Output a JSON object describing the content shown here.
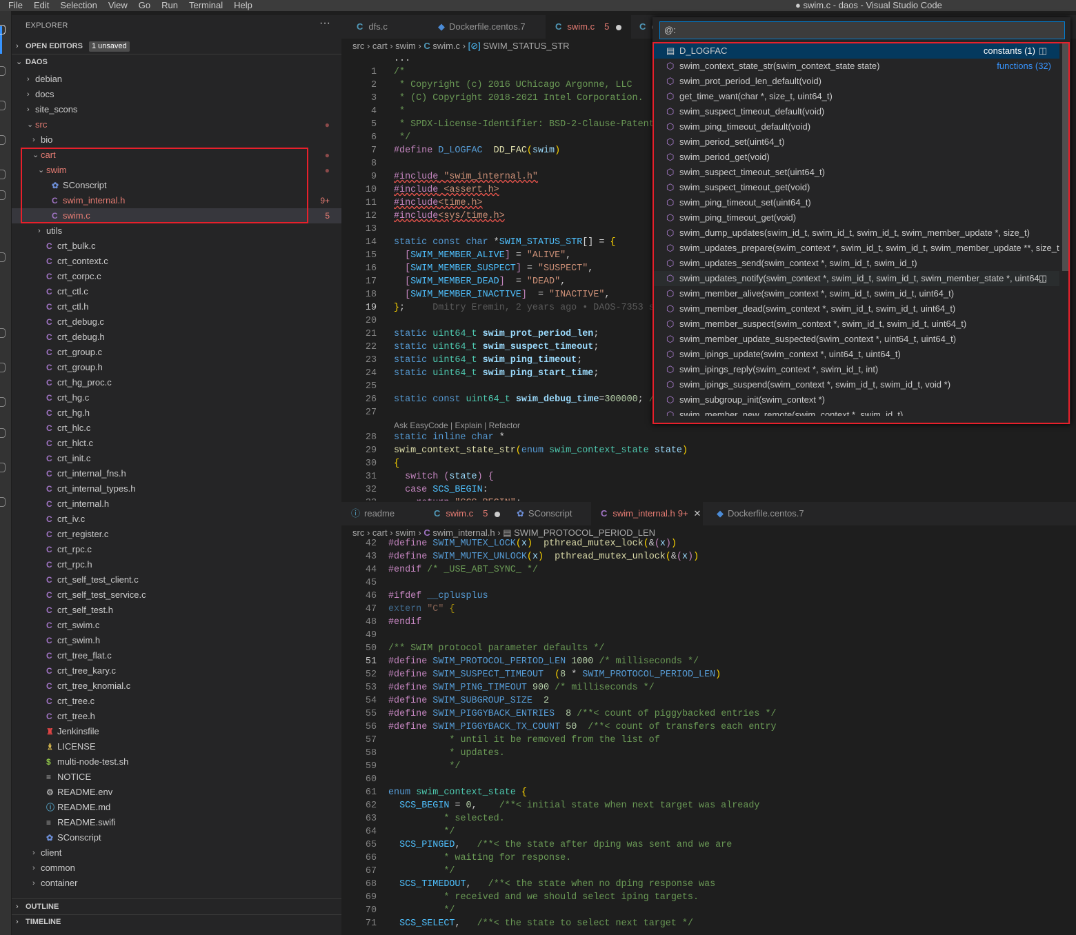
{
  "titlebar": {
    "menus": [
      "File",
      "Edit",
      "Selection",
      "View",
      "Go",
      "Run",
      "Terminal",
      "Help"
    ],
    "title": "● swim.c - daos - Visual Studio Code"
  },
  "explorer": {
    "header": "EXPLORER",
    "more": "···",
    "open_editors": {
      "label": "OPEN EDITORS",
      "badge": "1 unsaved"
    },
    "root": "DAOS",
    "rows": [
      {
        "label": "debian",
        "indent": 0,
        "twisty": "›"
      },
      {
        "label": "docs",
        "indent": 0,
        "twisty": "›"
      },
      {
        "label": "site_scons",
        "indent": 0,
        "twisty": "›"
      },
      {
        "label": "src",
        "indent": 0,
        "twisty": "⌄",
        "mod": true,
        "dot": "●"
      },
      {
        "label": "bio",
        "indent": 1,
        "twisty": "›"
      },
      {
        "label": "cart",
        "indent": 1,
        "twisty": "⌄",
        "mod": true,
        "dot": "●"
      },
      {
        "label": "swim",
        "indent": 2,
        "twisty": "⌄",
        "mod": true,
        "dot": "●"
      },
      {
        "label": "SConscript",
        "indent": 3,
        "icon": "✿",
        "iconColor": "#6d8fd8"
      },
      {
        "label": "swim_internal.h",
        "indent": 3,
        "icon": "C",
        "mod": true,
        "dec": "9+"
      },
      {
        "label": "swim.c",
        "indent": 3,
        "icon": "C",
        "mod": true,
        "dec": "5",
        "sel": true
      },
      {
        "label": "utils",
        "indent": 2,
        "twisty": "›"
      },
      {
        "label": "crt_bulk.c",
        "indent": 2,
        "icon": "C"
      },
      {
        "label": "crt_context.c",
        "indent": 2,
        "icon": "C"
      },
      {
        "label": "crt_corpc.c",
        "indent": 2,
        "icon": "C"
      },
      {
        "label": "crt_ctl.c",
        "indent": 2,
        "icon": "C"
      },
      {
        "label": "crt_ctl.h",
        "indent": 2,
        "icon": "C"
      },
      {
        "label": "crt_debug.c",
        "indent": 2,
        "icon": "C"
      },
      {
        "label": "crt_debug.h",
        "indent": 2,
        "icon": "C"
      },
      {
        "label": "crt_group.c",
        "indent": 2,
        "icon": "C"
      },
      {
        "label": "crt_group.h",
        "indent": 2,
        "icon": "C"
      },
      {
        "label": "crt_hg_proc.c",
        "indent": 2,
        "icon": "C"
      },
      {
        "label": "crt_hg.c",
        "indent": 2,
        "icon": "C"
      },
      {
        "label": "crt_hg.h",
        "indent": 2,
        "icon": "C"
      },
      {
        "label": "crt_hlc.c",
        "indent": 2,
        "icon": "C"
      },
      {
        "label": "crt_hlct.c",
        "indent": 2,
        "icon": "C"
      },
      {
        "label": "crt_init.c",
        "indent": 2,
        "icon": "C"
      },
      {
        "label": "crt_internal_fns.h",
        "indent": 2,
        "icon": "C"
      },
      {
        "label": "crt_internal_types.h",
        "indent": 2,
        "icon": "C"
      },
      {
        "label": "crt_internal.h",
        "indent": 2,
        "icon": "C"
      },
      {
        "label": "crt_iv.c",
        "indent": 2,
        "icon": "C"
      },
      {
        "label": "crt_register.c",
        "indent": 2,
        "icon": "C"
      },
      {
        "label": "crt_rpc.c",
        "indent": 2,
        "icon": "C"
      },
      {
        "label": "crt_rpc.h",
        "indent": 2,
        "icon": "C"
      },
      {
        "label": "crt_self_test_client.c",
        "indent": 2,
        "icon": "C"
      },
      {
        "label": "crt_self_test_service.c",
        "indent": 2,
        "icon": "C"
      },
      {
        "label": "crt_self_test.h",
        "indent": 2,
        "icon": "C"
      },
      {
        "label": "crt_swim.c",
        "indent": 2,
        "icon": "C"
      },
      {
        "label": "crt_swim.h",
        "indent": 2,
        "icon": "C"
      },
      {
        "label": "crt_tree_flat.c",
        "indent": 2,
        "icon": "C"
      },
      {
        "label": "crt_tree_kary.c",
        "indent": 2,
        "icon": "C"
      },
      {
        "label": "crt_tree_knomial.c",
        "indent": 2,
        "icon": "C"
      },
      {
        "label": "crt_tree.c",
        "indent": 2,
        "icon": "C"
      },
      {
        "label": "crt_tree.h",
        "indent": 2,
        "icon": "C"
      },
      {
        "label": "Jenkinsfile",
        "indent": 2,
        "icon": "♜",
        "iconColor": "#d44"
      },
      {
        "label": "LICENSE",
        "indent": 2,
        "icon": "♗",
        "iconColor": "#e0c050"
      },
      {
        "label": "multi-node-test.sh",
        "indent": 2,
        "icon": "$",
        "iconColor": "#8dc149"
      },
      {
        "label": "NOTICE",
        "indent": 2,
        "icon": "≡",
        "iconColor": "#aaa"
      },
      {
        "label": "README.env",
        "indent": 2,
        "icon": "⚙",
        "iconColor": "#aaa"
      },
      {
        "label": "README.md",
        "indent": 2,
        "icon": "ⓘ",
        "iconColor": "#519aba"
      },
      {
        "label": "README.swifi",
        "indent": 2,
        "icon": "≡",
        "iconColor": "#aaa"
      },
      {
        "label": "SConscript",
        "indent": 2,
        "icon": "✿",
        "iconColor": "#6d8fd8"
      },
      {
        "label": "client",
        "indent": 1,
        "twisty": "›"
      },
      {
        "label": "common",
        "indent": 1,
        "twisty": "›"
      },
      {
        "label": "container",
        "indent": 1,
        "twisty": "›"
      }
    ],
    "outline": "OUTLINE",
    "timeline": "TIMELINE"
  },
  "top_group": {
    "tabs": [
      {
        "label": "dfs.c"
      },
      {
        "label": "Dockerfile.centos.7"
      },
      {
        "label": "swim.c",
        "badge": "5"
      },
      {
        "label": "c"
      }
    ],
    "breadcrumb": [
      "src",
      "cart",
      "swim",
      "swim.c",
      "SWIM_STATUS_STR"
    ],
    "blame": "Dmitry Eremin, 2 years ago • DAOS-7353 s",
    "codelens": "Ask EasyCode | Explain | Refactor"
  },
  "bottom_group": {
    "tabs": [
      {
        "label": "readme"
      },
      {
        "label": "swim.c",
        "badge": "5"
      },
      {
        "label": "SConscript"
      },
      {
        "label": "swim_internal.h",
        "badge": "9+"
      },
      {
        "label": "Dockerfile.centos.7"
      }
    ],
    "breadcrumb": [
      "src",
      "cart",
      "swim",
      "swim_internal.h",
      "SWIM_PROTOCOL_PERIOD_LEN"
    ]
  },
  "quick_pick": {
    "query": "@:",
    "items": [
      {
        "label": "D_LOGFAC",
        "group": "constants (1)",
        "kind": "constant"
      },
      {
        "label": "swim_context_state_str(swim_context_state state)",
        "group": "functions (32)"
      },
      {
        "label": "swim_prot_period_len_default(void)"
      },
      {
        "label": "get_time_want(char *, size_t, uint64_t)"
      },
      {
        "label": "swim_suspect_timeout_default(void)"
      },
      {
        "label": "swim_ping_timeout_default(void)"
      },
      {
        "label": "swim_period_set(uint64_t)"
      },
      {
        "label": "swim_period_get(void)"
      },
      {
        "label": "swim_suspect_timeout_set(uint64_t)"
      },
      {
        "label": "swim_suspect_timeout_get(void)"
      },
      {
        "label": "swim_ping_timeout_set(uint64_t)"
      },
      {
        "label": "swim_ping_timeout_get(void)"
      },
      {
        "label": "swim_dump_updates(swim_id_t, swim_id_t, swim_id_t, swim_member_update *, size_t)"
      },
      {
        "label": "swim_updates_prepare(swim_context *, swim_id_t, swim_id_t, swim_member_update **, size_t..."
      },
      {
        "label": "swim_updates_send(swim_context *, swim_id_t, swim_id_t)"
      },
      {
        "label": "swim_updates_notify(swim_context *, swim_id_t, swim_id_t, swim_member_state *, uint64...",
        "hover": true
      },
      {
        "label": "swim_member_alive(swim_context *, swim_id_t, swim_id_t, uint64_t)"
      },
      {
        "label": "swim_member_dead(swim_context *, swim_id_t, swim_id_t, uint64_t)"
      },
      {
        "label": "swim_member_suspect(swim_context *, swim_id_t, swim_id_t, uint64_t)"
      },
      {
        "label": "swim_member_update_suspected(swim_context *, uint64_t, uint64_t)"
      },
      {
        "label": "swim_ipings_update(swim_context *, uint64_t, uint64_t)"
      },
      {
        "label": "swim_ipings_reply(swim_context *, swim_id_t, int)"
      },
      {
        "label": "swim_ipings_suspend(swim_context *, swim_id_t, swim_id_t, void *)"
      },
      {
        "label": "swim_subgroup_init(swim_context *)"
      },
      {
        "label": "swim_member_new_remote(swim_context *, swim_id_t)"
      }
    ]
  }
}
